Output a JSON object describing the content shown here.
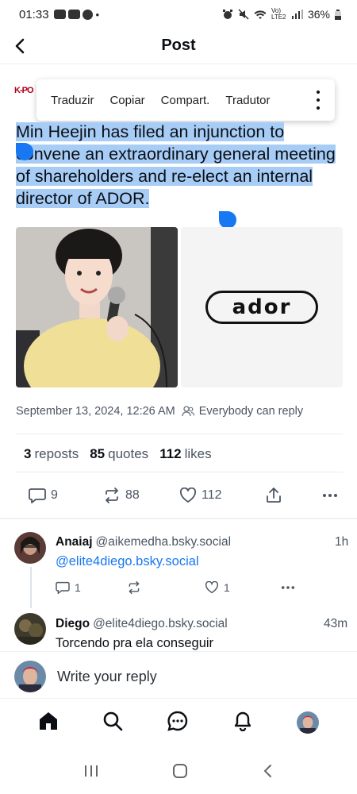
{
  "status_bar": {
    "time": "01:33",
    "dot": "•",
    "network": "Vo) LTE2",
    "battery": "36%"
  },
  "header": {
    "title": "Post",
    "back_icon": "chevron-left-icon"
  },
  "author_peek": {
    "handle_fragment": "K-PO"
  },
  "context_menu": {
    "items": [
      "Traduzir",
      "Copiar",
      "Compart.",
      "Tradutor"
    ],
    "more_icon": "vertical-dots-icon"
  },
  "post": {
    "text": "Min Heejin has filed an injunction to convene an extraordinary general meeting of shareholders and re-elect an internal director of ADOR.",
    "images": [
      {
        "icon": "photo-woman-microphone"
      },
      {
        "logo_text": "ador"
      }
    ],
    "timestamp": "September 13, 2024, 12:26 AM",
    "audience": "Everybody can reply",
    "stats": {
      "reposts_count": "3",
      "reposts_label": "reposts",
      "quotes_count": "85",
      "quotes_label": "quotes",
      "likes_count": "112",
      "likes_label": "likes"
    },
    "actions": {
      "replies": "9",
      "reposts": "88",
      "likes": "112"
    }
  },
  "replies": [
    {
      "name": "Anaiaj",
      "handle": "@aikemedha.bsky.social",
      "time": "1h",
      "mention": "@elite4diego.bsky.social",
      "replies": "1",
      "likes": "1"
    },
    {
      "name": "Diego",
      "handle": "@elite4diego.bsky.social",
      "time": "43m",
      "text": "Torcendo pra ela conseguir"
    }
  ],
  "composer": {
    "placeholder": "Write your reply"
  },
  "colors": {
    "accent": "#1877f2",
    "selection": "#a7cdf7",
    "muted_text": "#4b5563"
  }
}
